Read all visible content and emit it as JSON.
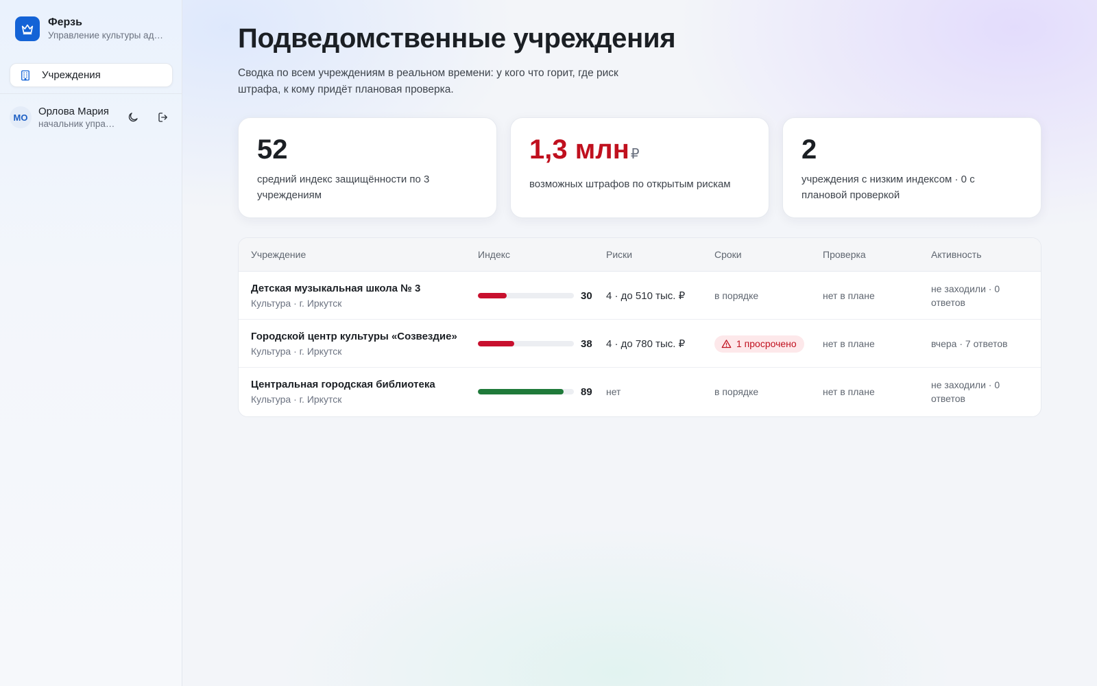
{
  "app": {
    "name": "Ферзь",
    "subtitle": "Управление культуры администрации",
    "brand_color": "#1463d6",
    "logo_icon": "crown-icon"
  },
  "sidebar": {
    "items": [
      {
        "label": "Учреждения",
        "icon": "building-icon",
        "active": true
      }
    ],
    "user": {
      "initials": "МО",
      "name": "Орлова Мария",
      "role": "начальник управления"
    },
    "actions": {
      "theme_icon": "moon-icon",
      "logout_icon": "logout-icon"
    }
  },
  "page": {
    "title": "Подведомственные учреждения",
    "description": "Сводка по всем учреждениям в реальном времени: у кого что горит, где риск штрафа, к кому придёт плановая проверка."
  },
  "stats": [
    {
      "value": "52",
      "unit": "",
      "label": "средний индекс защищённости по 3 учреждениям"
    },
    {
      "value": "1,3 млн",
      "unit": "₽",
      "label": "возможных штрафов по открытым рискам",
      "color": "#c0101e"
    },
    {
      "value": "2",
      "unit": "",
      "label": "учреждения с низким индексом · 0 с плановой проверкой"
    }
  ],
  "table": {
    "headers": {
      "name": "Учреждение",
      "index": "Индекс",
      "risks": "Риски",
      "deadlines": "Сроки",
      "check": "Проверка",
      "activity": "Активность"
    },
    "rows": [
      {
        "name": "Детская музыкальная школа № 3",
        "sub": "Культура · г. Иркутск",
        "index": 30,
        "index_display": "30",
        "index_color": "#c8102e",
        "risks": "4 · до 510 тыс. ₽",
        "deadlines": "в порядке",
        "check": "нет в плане",
        "activity": "не заходили · 0 ответов"
      },
      {
        "name": "Городской центр культуры «Созвездие»",
        "sub": "Культура · г. Иркутск",
        "index": 38,
        "index_display": "38",
        "index_color": "#c8102e",
        "risks": "4 · до 780 тыс. ₽",
        "deadlines": "1 просрочено",
        "deadlines_overdue": true,
        "check": "нет в плане",
        "activity": "вчера · 7 ответов"
      },
      {
        "name": "Центральная городская библиотека",
        "sub": "Культура · г. Иркутск",
        "index": 89,
        "index_display": "89",
        "index_color": "#1f7a3a",
        "risks": "нет",
        "deadlines": "в порядке",
        "check": "нет в плане",
        "activity": "не заходили · 0 ответов"
      }
    ]
  },
  "colors": {
    "danger": "#c0101e",
    "success": "#1f7a3a",
    "accent": "#1463d6"
  }
}
